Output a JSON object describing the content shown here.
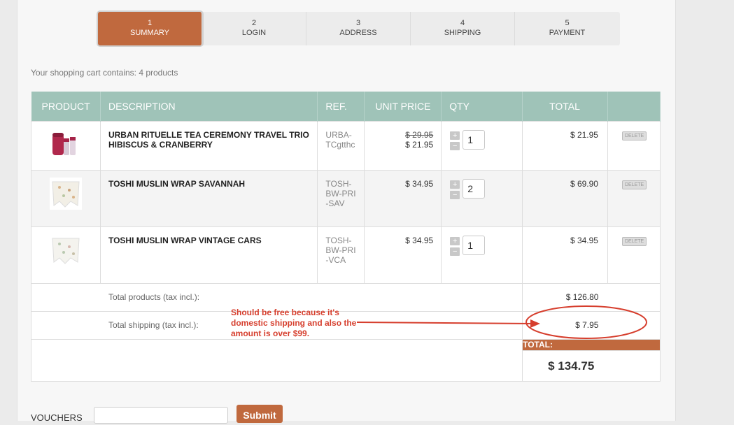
{
  "steps": [
    {
      "num": "1",
      "label": "SUMMARY"
    },
    {
      "num": "2",
      "label": "LOGIN"
    },
    {
      "num": "3",
      "label": "ADDRESS"
    },
    {
      "num": "4",
      "label": "SHIPPING"
    },
    {
      "num": "5",
      "label": "PAYMENT"
    }
  ],
  "cart_count_text": "Your shopping cart contains: 4 products",
  "table": {
    "headers": {
      "product": "PRODUCT",
      "description": "DESCRIPTION",
      "ref": "REF.",
      "unit_price": "UNIT PRICE",
      "qty": "QTY",
      "total": "TOTAL"
    },
    "rows": [
      {
        "name": "URBAN RITUELLE TEA CEREMONY TRAVEL TRIO HIBISCUS & CRANBERRY",
        "ref": "URBA-TCgtthc",
        "old_price": "$ 29.95",
        "price": "$ 21.95",
        "qty": "1",
        "total": "$ 21.95",
        "delete": "DELETE"
      },
      {
        "name": "TOSHI MUSLIN WRAP SAVANNAH",
        "ref": "TOSH-BW-PRI-SAV",
        "price": "$ 34.95",
        "qty": "2",
        "total": "$ 69.90",
        "delete": "DELETE"
      },
      {
        "name": "TOSHI MUSLIN WRAP VINTAGE CARS",
        "ref": "TOSH-BW-PRI-VCA",
        "price": "$ 34.95",
        "qty": "1",
        "total": "$ 34.95",
        "delete": "DELETE"
      }
    ],
    "qty_plus": "+",
    "qty_minus": "−",
    "total_products_label": "Total products (tax incl.):",
    "total_products": "$ 126.80",
    "total_shipping_label": "Total shipping (tax incl.):",
    "total_shipping": "$ 7.95",
    "total_label": "TOTAL:",
    "grand_total": "$ 134.75"
  },
  "annotation": "Should be free because it's domestic shipping and also the amount is over $99.",
  "vouchers": {
    "label": "VOUCHERS",
    "submit": "Submit"
  },
  "colors": {
    "accent": "#c0693e",
    "table_header": "#9fc3b8",
    "annotation": "#d63e2d"
  }
}
